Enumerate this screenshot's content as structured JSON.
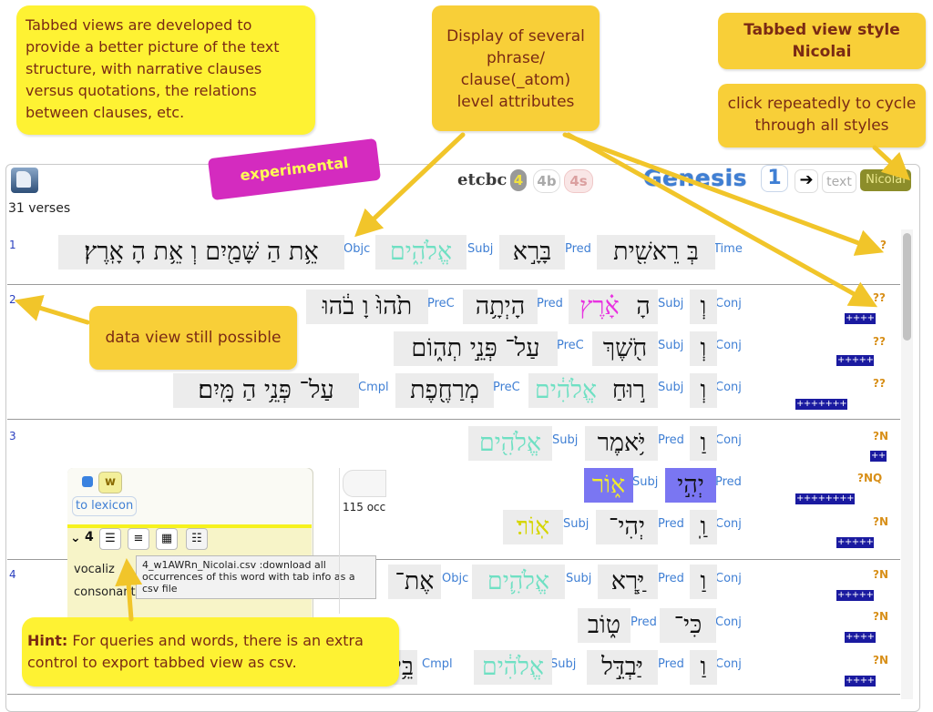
{
  "toolbar": {
    "verses_count": "31 verses",
    "source": "etcbc",
    "versions": [
      "4",
      "4b",
      "4s"
    ],
    "book": "Genesis",
    "chapter": "1",
    "text_style": "text",
    "active_style": "Nicolai"
  },
  "verses": [
    {
      "num": "1"
    },
    {
      "num": "2"
    },
    {
      "num": "3"
    },
    {
      "num": "4"
    }
  ],
  "hebrew": {
    "v1": [
      "בְּ רֵאשִׁ֖ית",
      "בָּרָ֣א",
      "אֱלֹהִ֑ים",
      "אֵ֥ת הַ שָּׁמַ֖יִם וְ אֵ֥ת הָ אָֽרֶץ׃"
    ],
    "v2a": [
      "וְ",
      "הָ",
      "אָ֗רֶץ",
      "הָיְתָ֥ה",
      "תֹ֙הוּ֙ וָ בֹ֔הוּ"
    ],
    "v2b": [
      "וְ",
      "חֹ֖שֶׁךְ",
      "עַל־ פְּנֵ֣י תְה֑וֹם"
    ],
    "v2c": [
      "וְ",
      "ר֣וּחַ",
      "אֱלֹהִ֔ים",
      "מְרַחֶ֖פֶת",
      "עַל־ פְּנֵ֥י הַ מָּֽיִם׃"
    ],
    "v3a": [
      "וַ",
      "יֹּ֥אמֶר",
      "אֱלֹהִ֖ים"
    ],
    "v3b": [
      "יְהִ֣י",
      "א֑וֹר"
    ],
    "v3c": [
      "וַֽ",
      "יְהִי־",
      "אֽוֹר׃"
    ],
    "v4a": [
      "וַ",
      "יַּ֧רְא",
      "אֱלֹהִ֛ים",
      "אֶת־"
    ],
    "v4b": [
      "כִּי־",
      "ט֑וֹב"
    ],
    "v4c": [
      "וַ",
      "יַּבְדֵּ֣ל",
      "אֱלֹהִ֔ים",
      "בֵּ֥ין"
    ]
  },
  "labels": {
    "time": "Time",
    "pred": "Pred",
    "subj": "Subj",
    "objc": "Objc",
    "conj": "Conj",
    "prec": "PreC",
    "cmpl": "Cmpl"
  },
  "codes": {
    "v1": "?",
    "v2a": "??",
    "v2b": "??",
    "v2c": "??",
    "v3a": "?N",
    "v3b": "?NQ",
    "v3c": "?N",
    "v4a": "?N",
    "v4b": "?N",
    "v4c": "?N"
  },
  "plus_marks": {
    "v2a": "++++",
    "v2b": "+++++",
    "v2c": "+++++++",
    "v3a": "++",
    "v3b": "++++++++",
    "v3c": "+++++",
    "v4a": "+++++",
    "v4b": "++++",
    "v4c": "++++"
  },
  "popup": {
    "w_button": "w",
    "lexicon_link": "to lexicon",
    "count_prefix": "4",
    "vocalized_label": "vocaliz",
    "consonantal_label": "consonantal",
    "tooltip": "4_w1AWRn_Nicolai.csv :download all occurrences of this word with tab info as a csv file",
    "occurrences": "115 occ"
  },
  "annotations": {
    "tabbed_views": "Tabbed views are developed to provide a better picture of the text structure, with narrative clauses versus quotations, the relations between clauses, etc.",
    "display_attrs": "Display of several phrase/ clause(_atom) level attributes",
    "style_name": "Tabbed view style Nicolai",
    "cycle": "click repeatedly to cycle through all styles",
    "experimental": "experimental",
    "data_view": "data view still possible",
    "hint_bold": "Hint:",
    "hint_text": " For queries and words, there is an extra control to export tabbed view as csv."
  },
  "colors": {
    "note_yellow": "#fef233",
    "note_orange": "#f8cf38",
    "experimental_magenta": "#d42bbf",
    "label_blue": "#3f7fd4",
    "plus_blue": "#1a1aa0",
    "code_orange": "#d8901a",
    "cyan_word": "#6fe0c3",
    "magenta_word": "#e832e0",
    "yellow_word": "#d5d500",
    "purple_bg": "#7a76f2"
  }
}
